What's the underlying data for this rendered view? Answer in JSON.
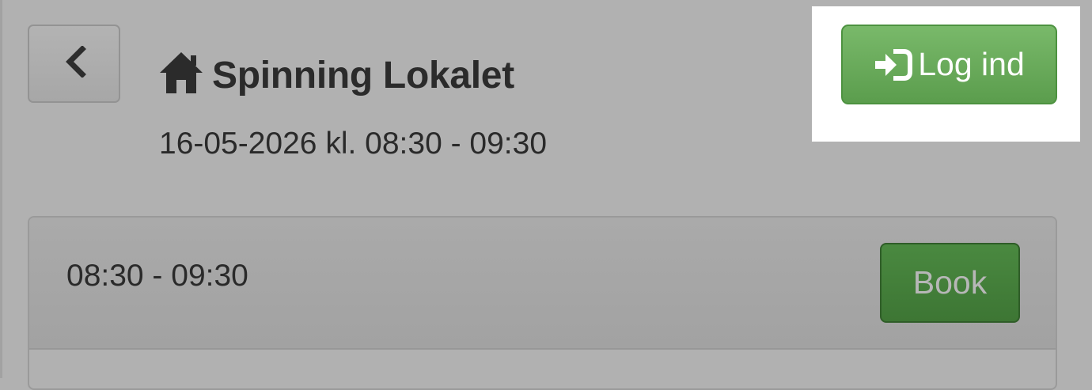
{
  "header": {
    "back_icon": "chevron-left-icon",
    "home_icon": "home-icon",
    "title": "Spinning Lokalet",
    "datetime": "16-05-2026 kl. 08:30 - 09:30"
  },
  "login": {
    "icon": "sign-in-icon",
    "label": "Log ind",
    "color": "#6aac5c"
  },
  "slots": [
    {
      "time": "08:30 - 09:30",
      "book_label": "Book",
      "book_color": "#44803a"
    }
  ],
  "colors": {
    "overlay": "#b1b1b1",
    "highlight": "#ffffff"
  }
}
